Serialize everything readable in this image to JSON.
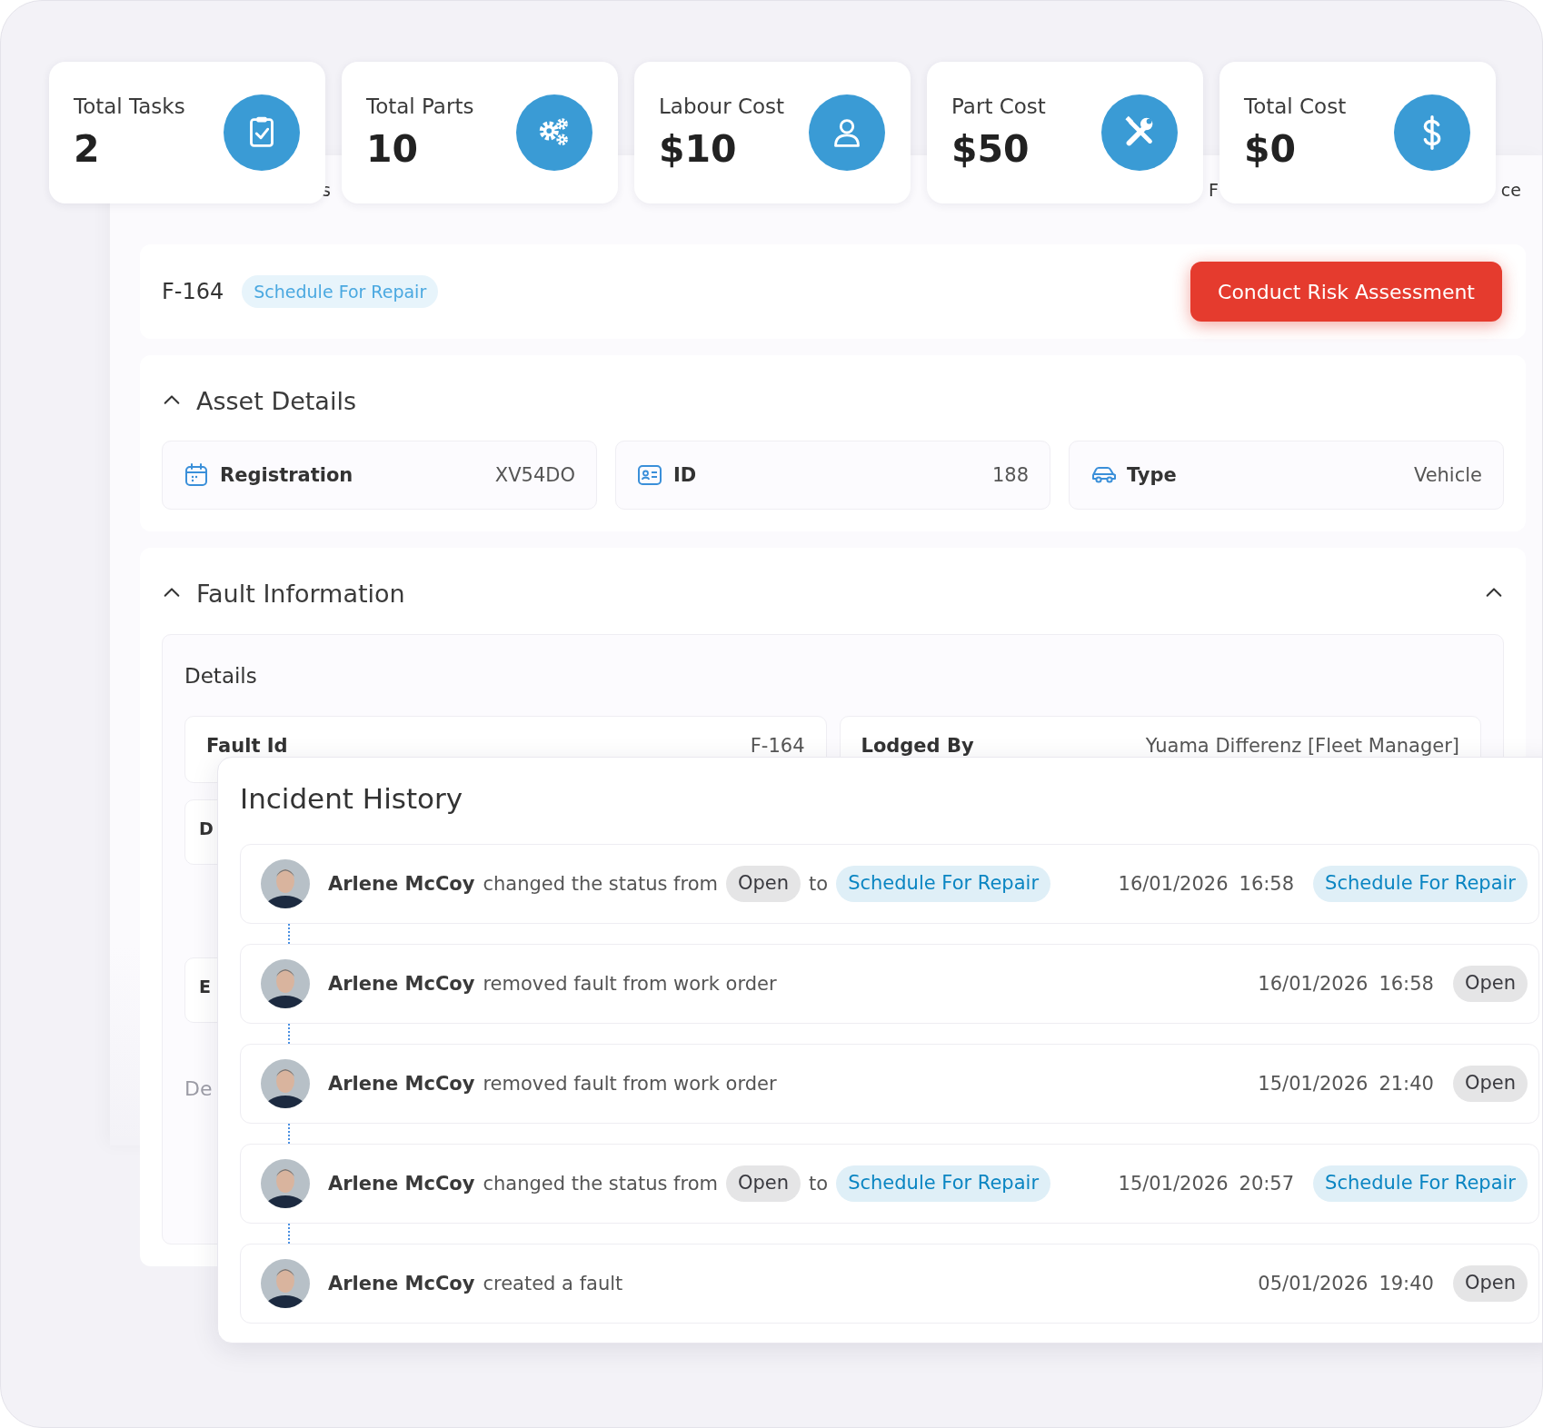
{
  "stat_cards": [
    {
      "label": "Total Tasks",
      "value": "2"
    },
    {
      "label": "Total Parts",
      "value": "10"
    },
    {
      "label": "Labour Cost",
      "value": "$10"
    },
    {
      "label": "Part Cost",
      "value": "$50"
    },
    {
      "label": "Total Cost",
      "value": "$0"
    }
  ],
  "background_tabs": [
    {
      "label": "s"
    },
    {
      "label": "F"
    },
    {
      "label": "ce"
    }
  ],
  "fault": {
    "id": "F-164",
    "status": {
      "label": "Schedule For Repair",
      "color": "#4aa8e0"
    },
    "action_button": "Conduct Risk Assessment"
  },
  "asset_details": {
    "title": "Asset Details",
    "expanded": true,
    "fields": [
      {
        "label": "Registration",
        "value": "XV54DO"
      },
      {
        "label": "ID",
        "value": "188"
      },
      {
        "label": "Type",
        "value": "Vehicle"
      }
    ]
  },
  "fault_information": {
    "title": "Fault Information",
    "expanded": true,
    "details": {
      "title": "Details",
      "fields": [
        {
          "label": "Fault Id",
          "value": "F-164"
        },
        {
          "label": "Lodged By",
          "value": "Yuama Differenz [Fleet Manager]"
        },
        {
          "label": "D"
        },
        {
          "label": "E"
        }
      ],
      "next_section": "De"
    }
  },
  "incident_history": {
    "title": "Incident History",
    "entries": [
      {
        "kind": "status_change",
        "user": "Arlene McCoy",
        "text": "changed the status from",
        "from": {
          "label": "Open",
          "color": "#3a3a40"
        },
        "joiner": "to",
        "to": {
          "label": "Schedule For Repair",
          "color": "#0a85c2"
        },
        "date": "16/01/2026",
        "time": "16:58",
        "status": {
          "label": "Schedule For Repair",
          "color": "#0a85c2"
        }
      },
      {
        "kind": "event",
        "user": "Arlene McCoy",
        "text": "removed fault from work order",
        "date": "16/01/2026",
        "time": "16:58",
        "status": {
          "label": "Open",
          "color": "#3a3a40"
        }
      },
      {
        "kind": "event",
        "user": "Arlene McCoy",
        "text": "removed fault from work order",
        "date": "15/01/2026",
        "time": "21:40",
        "status": {
          "label": "Open",
          "color": "#3a3a40"
        }
      },
      {
        "kind": "status_change",
        "user": "Arlene McCoy",
        "text": "changed the status from",
        "from": {
          "label": "Open",
          "color": "#3a3a40"
        },
        "joiner": "to",
        "to": {
          "label": "Schedule For Repair",
          "color": "#0a85c2"
        },
        "date": "15/01/2026",
        "time": "20:57",
        "status": {
          "label": "Schedule For Repair",
          "color": "#0a85c2"
        }
      },
      {
        "kind": "event",
        "user": "Arlene McCoy",
        "text": "created a fault",
        "date": "05/01/2026",
        "time": "19:40",
        "status": {
          "label": "Open",
          "color": "#3a3a40"
        }
      }
    ]
  }
}
